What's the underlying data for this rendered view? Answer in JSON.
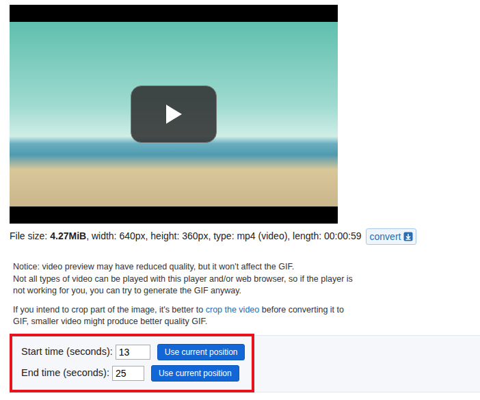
{
  "video": {
    "playing": false
  },
  "file_info": {
    "size_label": "File size:",
    "size": "4.27MiB",
    "details": ", width: 640px, height: 360px, type: mp4 (video), length: 00:00:59"
  },
  "convert_button": "convert",
  "notice": [
    "Notice: video preview may have reduced quality, but it won't affect the GIF.",
    "Not all types of video can be played with this player and/or web browser, so if the player is not working for you, you can try to generate the GIF anyway."
  ],
  "tip": {
    "before": "If you intend to crop part of the image, it's better to",
    "link": "crop the video",
    "after": "before converting it to GIF, smaller video might produce better quality GIF."
  },
  "fields": [
    {
      "label": "Start time (seconds):",
      "value": "13",
      "button": "Use current position"
    },
    {
      "label": "End time (seconds):",
      "value": "25",
      "button": "Use current position"
    }
  ]
}
